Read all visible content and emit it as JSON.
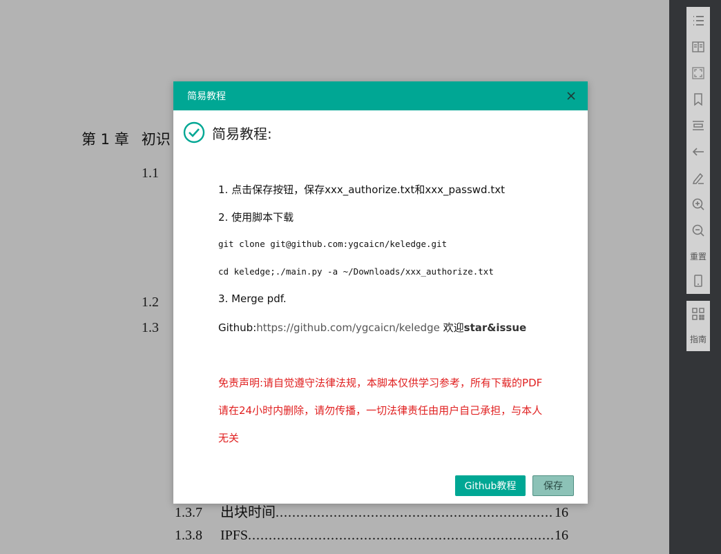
{
  "document": {
    "chapter_num": "第 1 章",
    "chapter_title": "初识",
    "sections": [
      "1.1",
      "1.2",
      "1.3"
    ],
    "toc": [
      {
        "num": "1.3.7",
        "title": "出块时间",
        "page": "16"
      },
      {
        "num": "1.3.8",
        "title": "IPFS",
        "page": "16"
      }
    ]
  },
  "toolbar": {
    "icons": [
      "list-icon",
      "book-icon",
      "fullscreen-icon",
      "bookmark-icon",
      "layout-icon",
      "back-icon",
      "edit-icon",
      "zoom-in-icon",
      "zoom-out-icon"
    ],
    "reset_label": "重置",
    "guide_label": "指南"
  },
  "modal": {
    "header_title": "简易教程",
    "heading": "简易教程:",
    "step1": "1. 点击保存按钮，保存xxx_authorize.txt和xxx_passwd.txt",
    "step2": "2. 使用脚本下载",
    "cmd1": "git clone git@github.com:ygcaicn/keledge.git",
    "cmd2": "cd keledge;./main.py -a ~/Downloads/xxx_authorize.txt",
    "step3": "3. Merge pdf.",
    "github_prefix": "Github:",
    "github_url": "https://github.com/ygcaicn/keledge",
    "welcome": " 欢迎",
    "star_issue": "star&issue",
    "disclaimer_1": "免责声明:请自觉遵守法律法规，本脚本仅供学习参考，所有下载的PDF",
    "disclaimer_2": "请在24小时内删除，请勿传播，一切法律责任由用户自己承担，与本人",
    "disclaimer_3": "无关",
    "btn_github": "Github教程",
    "btn_save": "保存"
  },
  "colors": {
    "accent": "#00a794",
    "danger": "#e02020",
    "toolbar_bg": "#333538"
  }
}
